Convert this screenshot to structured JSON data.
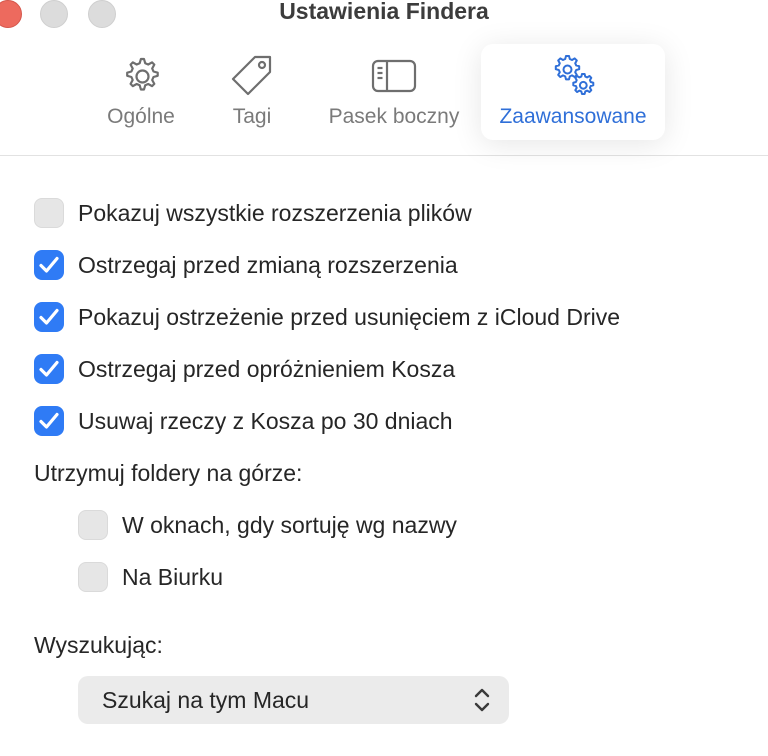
{
  "window": {
    "title": "Ustawienia Findera"
  },
  "tabs": [
    {
      "label": "Ogólne",
      "icon": "gear-icon",
      "active": false
    },
    {
      "label": "Tagi",
      "icon": "tag-icon",
      "active": false
    },
    {
      "label": "Pasek boczny",
      "icon": "sidebar-icon",
      "active": false
    },
    {
      "label": "Zaawansowane",
      "icon": "gears-icon",
      "active": true
    }
  ],
  "options": [
    {
      "label": "Pokazuj wszystkie rozszerzenia plików",
      "checked": false
    },
    {
      "label": "Ostrzegaj przed zmianą rozszerzenia",
      "checked": true
    },
    {
      "label": "Pokazuj ostrzeżenie przed usunięciem z iCloud Drive",
      "checked": true
    },
    {
      "label": "Ostrzegaj przed opróżnieniem Kosza",
      "checked": true
    },
    {
      "label": "Usuwaj rzeczy z Kosza po 30 dniach",
      "checked": true
    }
  ],
  "folders_on_top": {
    "heading": "Utrzymuj foldery na górze:",
    "options": [
      {
        "label": "W oknach, gdy sortuję wg nazwy",
        "checked": false
      },
      {
        "label": "Na Biurku",
        "checked": false
      }
    ]
  },
  "search": {
    "heading": "Wyszukując:",
    "selected": "Szukaj na tym Macu"
  },
  "colors": {
    "accent": "#2f7bf5",
    "active_tab_text": "#2f6fd8",
    "close_button": "#ed6a5e"
  }
}
